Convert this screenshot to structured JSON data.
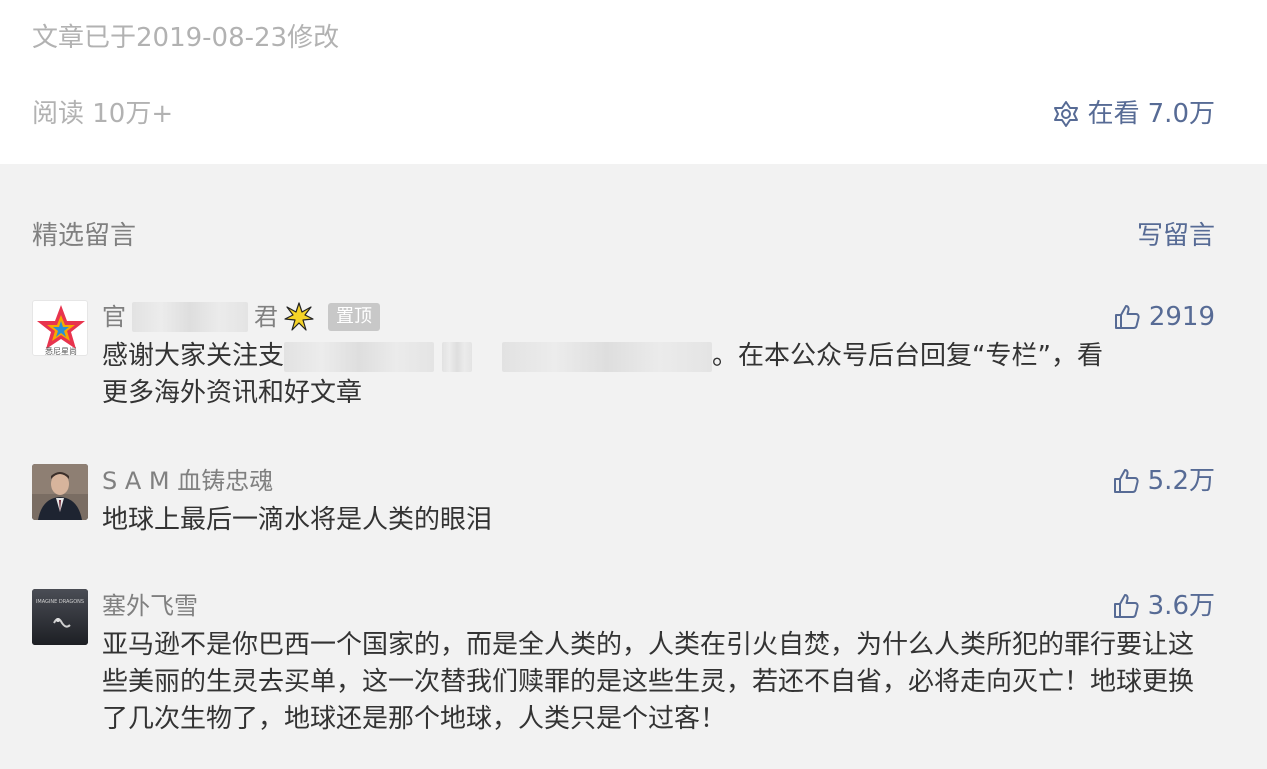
{
  "article": {
    "modified_text": "文章已于2019-08-23修改",
    "reads_text": "阅读 10万+",
    "watching_label": "在看",
    "watching_count": "7.0万"
  },
  "comments_section": {
    "title": "精选留言",
    "write_label": "写留言"
  },
  "comments": [
    {
      "nick_start": "官",
      "nick_end": "君",
      "pinned_label": "置顶",
      "likes": "2919",
      "text_start": "感谢大家关注支",
      "text_end": "。在本公众号后台回复“专栏”，看",
      "text_line2": "更多海外资讯和好文章",
      "avatar_text": "悉尼星尚"
    },
    {
      "nick": "S A M 血铸忠魂",
      "likes": "5.2万",
      "text": "地球上最后一滴水将是人类的眼泪"
    },
    {
      "nick": "塞外飞雪",
      "likes": "3.6万",
      "avatar_text": "IMAGINE DRAGONS",
      "text": "亚马逊不是你巴西一个国家的，而是全人类的，人类在引火自焚，为什么人类所犯的罪行要让这些美丽的生灵去买单，这一次替我们赎罪的是这些生灵，若还不自省，必将走向灭亡！地球更换了几次生物了，地球还是那个地球，人类只是个过客！"
    }
  ],
  "colors": {
    "link_blue": "#576b95",
    "gray_text": "#b2b2b2",
    "body_text": "#333333"
  },
  "icons": [
    "watching-icon",
    "thumbs-up-icon",
    "starburst-icon"
  ]
}
